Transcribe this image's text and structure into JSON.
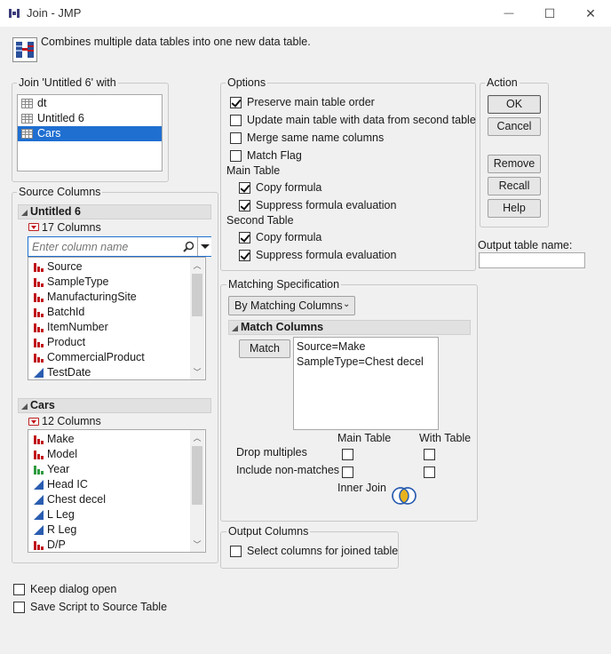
{
  "window": {
    "title": "Join - JMP",
    "minimize": "—",
    "maximize": "☐",
    "close": "✕"
  },
  "header": {
    "description": "Combines multiple data tables into one new data table."
  },
  "join_with": {
    "legend": "Join 'Untitled 6' with",
    "tables": [
      {
        "name": "dt",
        "selected": false
      },
      {
        "name": "Untitled 6",
        "selected": false
      },
      {
        "name": "Cars",
        "selected": true
      }
    ]
  },
  "source": {
    "legend": "Source Columns",
    "table1": {
      "name": "Untitled 6",
      "count": "17 Columns",
      "search_placeholder": "Enter column name",
      "columns": [
        {
          "name": "Source",
          "type": "nominal"
        },
        {
          "name": "SampleType",
          "type": "nominal"
        },
        {
          "name": "ManufacturingSite",
          "type": "nominal"
        },
        {
          "name": "BatchId",
          "type": "nominal"
        },
        {
          "name": "ItemNumber",
          "type": "nominal"
        },
        {
          "name": "Product",
          "type": "nominal"
        },
        {
          "name": "CommercialProduct",
          "type": "nominal"
        },
        {
          "name": "TestDate",
          "type": "continuous"
        }
      ]
    },
    "table2": {
      "name": "Cars",
      "count": "12 Columns",
      "columns": [
        {
          "name": "Make",
          "type": "nominal"
        },
        {
          "name": "Model",
          "type": "nominal"
        },
        {
          "name": "Year",
          "type": "ordinal"
        },
        {
          "name": "Head IC",
          "type": "continuous"
        },
        {
          "name": "Chest decel",
          "type": "continuous"
        },
        {
          "name": "L Leg",
          "type": "continuous"
        },
        {
          "name": "R Leg",
          "type": "continuous"
        },
        {
          "name": "D/P",
          "type": "nominal"
        }
      ]
    }
  },
  "options": {
    "legend": "Options",
    "preserve_order": {
      "label": "Preserve main table order",
      "checked": true
    },
    "update_main": {
      "label": "Update main table with data from second table",
      "checked": false
    },
    "merge_same": {
      "label": "Merge same name columns",
      "checked": false
    },
    "match_flag": {
      "label": "Match Flag",
      "checked": false
    },
    "main_table_heading": "Main Table",
    "main_copy_formula": {
      "label": "Copy formula",
      "checked": true
    },
    "main_suppress": {
      "label": "Suppress formula evaluation",
      "checked": true
    },
    "second_table_heading": "Second Table",
    "second_copy_formula": {
      "label": "Copy formula",
      "checked": true
    },
    "second_suppress": {
      "label": "Suppress formula evaluation",
      "checked": true
    }
  },
  "action": {
    "legend": "Action",
    "ok": "OK",
    "cancel": "Cancel",
    "remove": "Remove",
    "recall": "Recall",
    "help": "Help"
  },
  "output_name": {
    "label": "Output table name:",
    "value": ""
  },
  "matching": {
    "legend": "Matching Specification",
    "method": "By Matching Columns",
    "match_columns_heading": "Match Columns",
    "match_button": "Match",
    "pairs": [
      "Source=Make",
      "SampleType=Chest decel"
    ],
    "main_table_col": "Main Table",
    "with_table_col": "With Table",
    "drop_multiples": "Drop multiples",
    "include_nonmatches": "Include non-matches",
    "inner_join": "Inner Join"
  },
  "output_columns": {
    "legend": "Output Columns",
    "select_cols": {
      "label": "Select columns for joined table",
      "checked": false
    }
  },
  "footer": {
    "keep_open": {
      "label": "Keep dialog open",
      "checked": false
    },
    "save_script": {
      "label": "Save Script to Source Table",
      "checked": false
    }
  },
  "colors": {
    "selection": "#1f6fd1",
    "nominal_icon": "#c0141a",
    "ordinal_icon": "#2e9a3e",
    "continuous_icon": "#2a5db0"
  }
}
